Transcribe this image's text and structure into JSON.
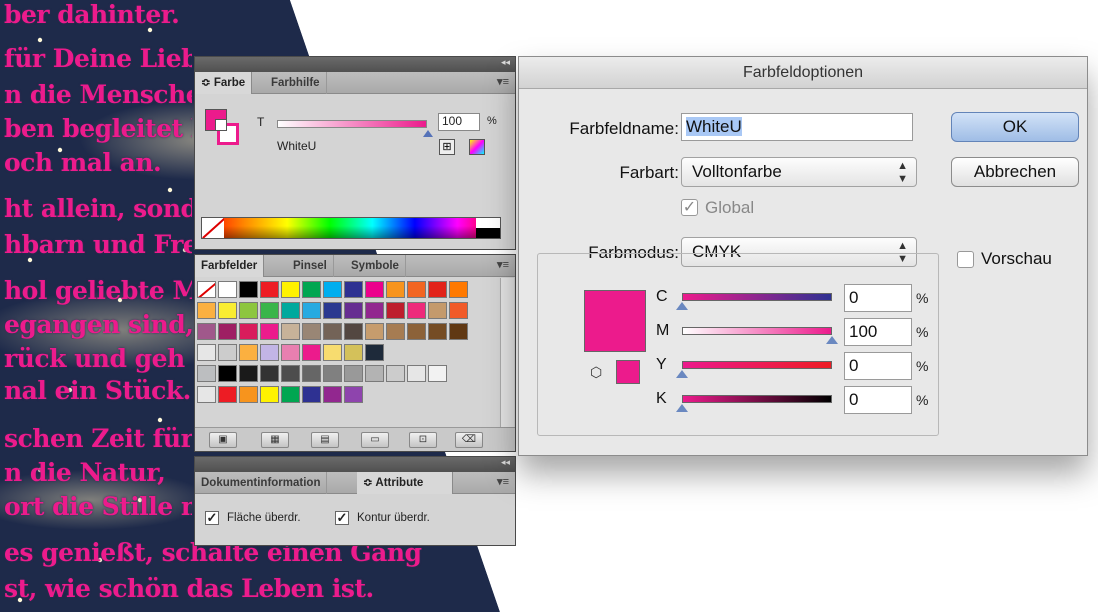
{
  "artwork": {
    "lines": [
      "ber dahinter.",
      "für Deine Lieb",
      "n die Mensche",
      "ben begleitet h",
      "och mal an.",
      "ht allein, sonde",
      "hbarn und Freu",
      "hol geliebte M",
      "egangen sind,",
      "rück und geh",
      "nal ein Stück.",
      "schen Zeit für",
      "n die Natur,",
      "ort die Stille m",
      "es genießt, schalte einen Gang",
      "st, wie schön das Leben ist."
    ],
    "text_color": "#ec1b8c",
    "bg_color": "#1e2a4a"
  },
  "farbe_panel": {
    "tabs": [
      "Farbe",
      "Farbhilfe"
    ],
    "tint_label": "T",
    "tint_value": "100",
    "tint_unit": "%",
    "swatch_name": "WhiteU",
    "fill_color": "#ec1b8c"
  },
  "farbfelder_panel": {
    "tabs": [
      "Farbfelder",
      "Pinsel",
      "Symbole"
    ],
    "swatch_rows": [
      [
        "none",
        "#ffffff",
        "#000000",
        "#ed1c24",
        "#fff200",
        "#00a651",
        "#00aeef",
        "#2e3192",
        "#ec008c",
        "#f7941d",
        "#f26522",
        "#e2231a",
        "#ff7900"
      ],
      [
        "#fbb040",
        "#f9ed32",
        "#8dc63f",
        "#39b54a",
        "#00a99d",
        "#27aae1",
        "#2b3990",
        "#662d91",
        "#92278f",
        "#be1e2d",
        "#ee2a7b",
        "#c49a6c",
        "#f15a29"
      ],
      [
        "#a0588b",
        "#9e1f63",
        "#d91c5c",
        "#ec1b8c",
        "#c7b299",
        "#998675",
        "#736357",
        "#534741",
        "#c69c6d",
        "#a67c52",
        "#8c6239",
        "#754c24",
        "#603813"
      ],
      [
        "#e6e6e6",
        "#cccccc",
        "#fbb040",
        "#c2b5e6",
        "#e87fb0",
        "#ec1b8c",
        "#f7dc6f",
        "#d4c15a",
        "#1e2a3a"
      ],
      [
        "#bcbec0",
        "#000000",
        "#1a1a1a",
        "#333333",
        "#4d4d4d",
        "#666666",
        "#808080",
        "#999999",
        "#b3b3b3",
        "#cccccc",
        "#e6e6e6",
        "#f2f2f2"
      ],
      [
        "#e6e6e6",
        "#ed1c24",
        "#f7941d",
        "#fff200",
        "#00a651",
        "#2e3192",
        "#92278f",
        "#8e44ad"
      ]
    ]
  },
  "attribute_panel": {
    "tabs": [
      "Dokumentinformation",
      "Attribute"
    ],
    "checkbox_fill_label": "Fläche überdr.",
    "checkbox_stroke_label": "Kontur überdr."
  },
  "dialog": {
    "title": "Farbfeldoptionen",
    "name_label": "Farbfeldname:",
    "name_value": "WhiteU",
    "type_label": "Farbart:",
    "type_value": "Volltonfarbe",
    "global_label": "Global",
    "mode_label": "Farbmodus:",
    "mode_value": "CMYK",
    "ok_label": "OK",
    "cancel_label": "Abbrechen",
    "preview_label": "Vorschau",
    "preview_color": "#ec1b8c",
    "inks": [
      {
        "label": "C",
        "value": "0",
        "unit": "%",
        "fraction": 0.0,
        "gradient": "linear-gradient(90deg, #ec1b8c, #2e3192)"
      },
      {
        "label": "M",
        "value": "100",
        "unit": "%",
        "fraction": 1.0,
        "gradient": "linear-gradient(90deg, #ffffff, #ec1b8c)"
      },
      {
        "label": "Y",
        "value": "0",
        "unit": "%",
        "fraction": 0.0,
        "gradient": "linear-gradient(90deg, #ec1b8c, #ed1c24)"
      },
      {
        "label": "K",
        "value": "0",
        "unit": "%",
        "fraction": 0.0,
        "gradient": "linear-gradient(90deg, #ec1b8c, #000000)"
      }
    ]
  }
}
